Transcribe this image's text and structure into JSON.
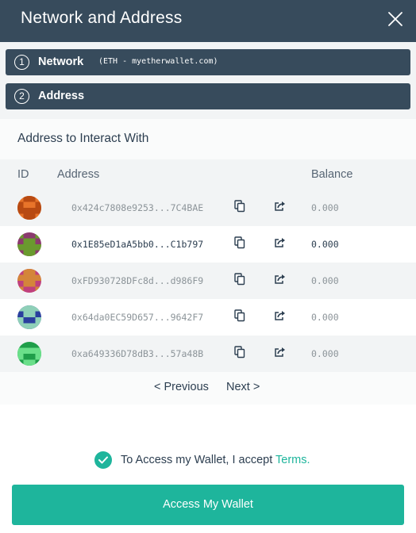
{
  "modal": {
    "title": "Network and Address"
  },
  "steps": [
    {
      "number": "1",
      "title": "Network",
      "subtitle": "(ETH - myetherwallet.com)"
    },
    {
      "number": "2",
      "title": "Address"
    }
  ],
  "address_panel": {
    "title": "Address to Interact With",
    "columns": {
      "id": "ID",
      "address": "Address",
      "balance": "Balance"
    },
    "rows": [
      {
        "address": "0x424c7808e9253...7C4BAE",
        "balance": "0.000",
        "avatar_colors": [
          "#e8742a",
          "#b84a12"
        ]
      },
      {
        "address": "0x1E85eD1aA5bb0...C1b797",
        "balance": "0.000",
        "avatar_colors": [
          "#8b3a6e",
          "#6a9a2e"
        ]
      },
      {
        "address": "0xFD930728DFc8d...d986F9",
        "balance": "0.000",
        "avatar_colors": [
          "#c0407c",
          "#d4853a"
        ]
      },
      {
        "address": "0x64da0EC59D657...9642F7",
        "balance": "0.000",
        "avatar_colors": [
          "#2a3f9e",
          "#8fd0b8"
        ]
      },
      {
        "address": "0xa649336D78dB3...57a48B",
        "balance": "0.000",
        "avatar_colors": [
          "#1f9e4a",
          "#6adf8a"
        ]
      }
    ],
    "pagination": {
      "previous": "< Previous",
      "next": "Next >"
    }
  },
  "terms": {
    "text": "To Access my Wallet, I accept",
    "link": "Terms."
  },
  "access_button": "Access My Wallet",
  "colors": {
    "header": "#374b5c",
    "accent": "#1eb59c"
  },
  "icons": {
    "close": "close-icon",
    "copy": "copy-icon",
    "share": "share-icon",
    "check": "checkmark-icon"
  }
}
